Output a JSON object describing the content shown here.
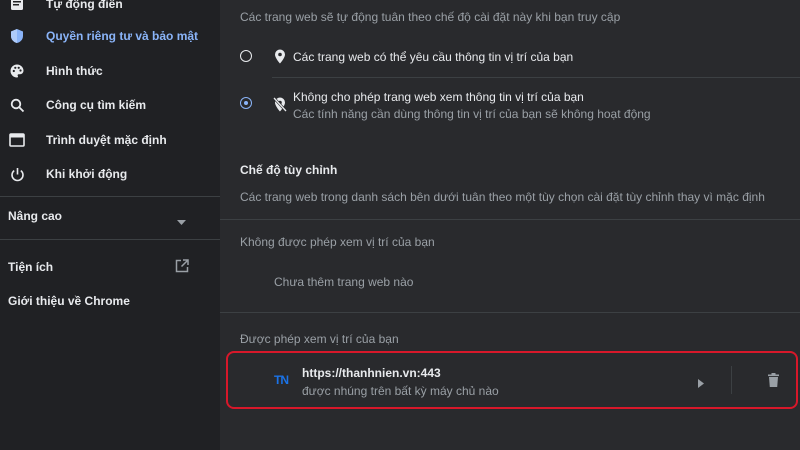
{
  "sidebar": {
    "items": [
      {
        "label": "Tự động điền",
        "icon": "autofill-icon"
      },
      {
        "label": "Quyền riêng tư và bảo mật",
        "icon": "shield-icon",
        "active": true
      },
      {
        "label": "Hình thức",
        "icon": "palette-icon"
      },
      {
        "label": "Công cụ tìm kiếm",
        "icon": "search-icon"
      },
      {
        "label": "Trình duyệt mặc định",
        "icon": "browser-icon"
      },
      {
        "label": "Khi khởi động",
        "icon": "power-icon"
      }
    ],
    "advanced_label": "Nâng cao",
    "extensions_label": "Tiện ích",
    "about_label": "Giới thiệu về Chrome"
  },
  "main": {
    "intro": "Các trang web sẽ tự động tuân theo chế độ cài đặt này khi bạn truy cập",
    "option_allow": {
      "title": "Các trang web có thể yêu cầu thông tin vị trí của bạn",
      "selected": false
    },
    "option_block": {
      "title": "Không cho phép trang web xem thông tin vị trí của bạn",
      "subtitle": "Các tính năng cần dùng thông tin vị trí của bạn sẽ không hoạt động",
      "selected": true
    },
    "custom_header": "Chế độ tùy chỉnh",
    "custom_desc": "Các trang web trong danh sách bên dưới tuân theo một tùy chọn cài đặt tùy chỉnh thay vì mặc định",
    "blocked_header": "Không được phép xem vị trí của bạn",
    "blocked_empty": "Chưa thêm trang web nào",
    "allowed_header": "Được phép xem vị trí của bạn",
    "allowed_site": {
      "url": "https://thanhnien.vn:443",
      "subtitle": "được nhúng trên bất kỳ máy chủ nào",
      "favicon_text": "TN"
    }
  },
  "colors": {
    "accent": "#8ab4f8",
    "highlight": "#d7182a",
    "favicon": "#1a73e8"
  }
}
